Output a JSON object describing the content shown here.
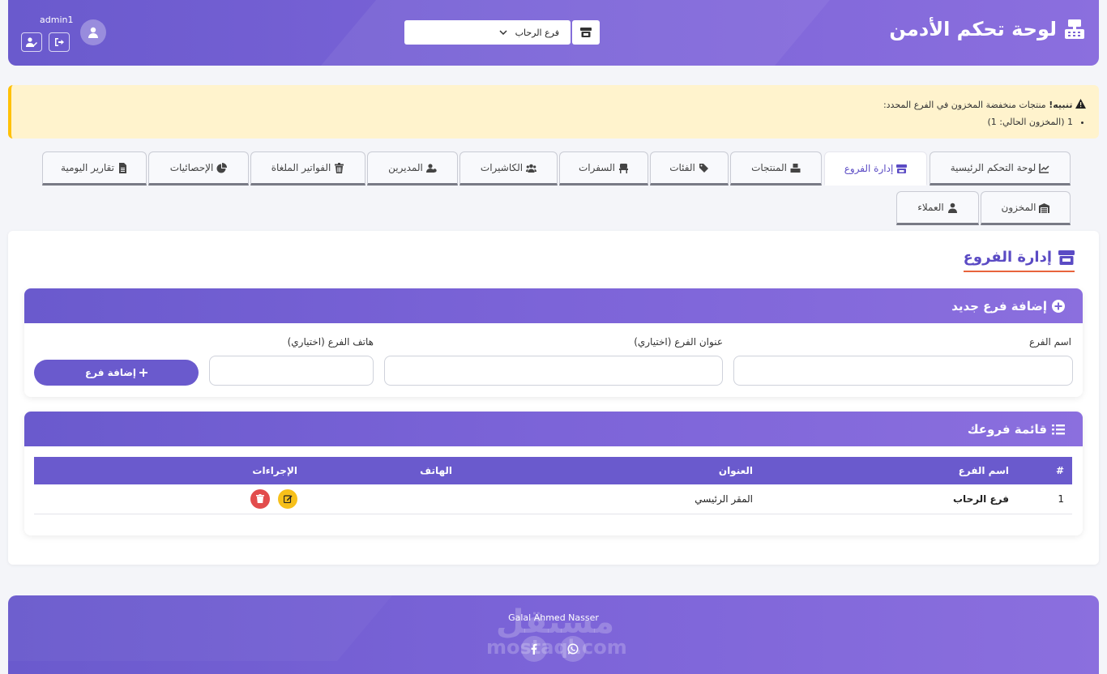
{
  "header": {
    "title": "لوحة تحكم الأدمن",
    "branch_selected": "فرع الرحاب",
    "username": "admin1"
  },
  "alert": {
    "title": "تنبيه!",
    "message": "منتجات منخفضة المخزون في الفرع المحدد:",
    "items": [
      "1 (المخزون الحالي: 1)"
    ]
  },
  "tabs": [
    {
      "label": "لوحة التحكم الرئيسية",
      "icon": "chart-line-icon"
    },
    {
      "label": "إدارة الفروع",
      "icon": "store-icon",
      "active": true
    },
    {
      "label": "المنتجات",
      "icon": "boxes-icon"
    },
    {
      "label": "الفئات",
      "icon": "tags-icon"
    },
    {
      "label": "السفرات",
      "icon": "chair-icon"
    },
    {
      "label": "الكاشيرات",
      "icon": "users-icon"
    },
    {
      "label": "المديرين",
      "icon": "user-tie-icon"
    },
    {
      "label": "الفواتير الملغاة",
      "icon": "trash-icon"
    },
    {
      "label": "الإحصائيات",
      "icon": "pie-chart-icon"
    },
    {
      "label": "تقارير اليومية",
      "icon": "file-icon"
    },
    {
      "label": "المخزون",
      "icon": "warehouse-icon"
    },
    {
      "label": "العملاء",
      "icon": "user-icon"
    }
  ],
  "main": {
    "title": "إدارة الفروع",
    "add_card": {
      "title": "إضافة فرع جديد",
      "name_label": "اسم الفرع",
      "address_label": "عنوان الفرع (اختياري)",
      "phone_label": "هاتف الفرع (اختياري)",
      "name_value": "",
      "address_value": "",
      "phone_value": "",
      "submit_label": "إضافة فرع"
    },
    "list_card": {
      "title": "قائمة فروعك",
      "columns": [
        "#",
        "اسم الفرع",
        "العنوان",
        "الهاتف",
        "الإجراءات"
      ],
      "rows": [
        {
          "num": "1",
          "name": "فرع الرحاب",
          "address": "المقر الرئيسي",
          "phone": ""
        }
      ]
    }
  },
  "footer": {
    "credit": "Galal Ahmed Nasser",
    "watermark_ar": "مستقل",
    "watermark_en": "mostaql.com"
  },
  "colors": {
    "primary": "#6a5acd",
    "accent_underline": "#e8643c",
    "alert_bg": "#fff3cd",
    "edit": "#f7c01a",
    "delete": "#e24c4c"
  }
}
